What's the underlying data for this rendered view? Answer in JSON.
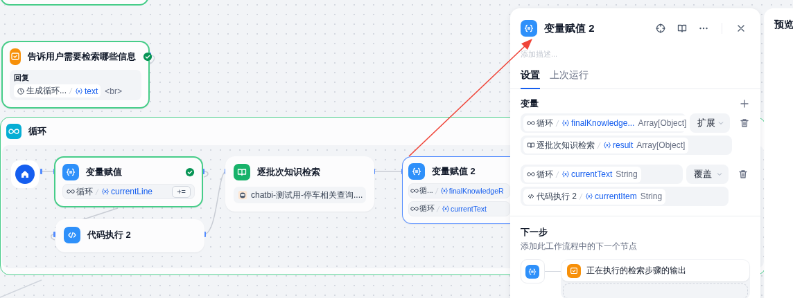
{
  "canvas": {
    "answer_node": {
      "kind": "answer",
      "title": "告诉用户需要检索哪些信息",
      "succeeded": true,
      "section_label": "回复",
      "ref": {
        "source": {
          "kind": "llm",
          "name": "生成循环..."
        },
        "var": "text"
      },
      "suffix": "<br>"
    },
    "loop_node": {
      "kind": "loop",
      "title": "循环",
      "succeeded": true,
      "children": [
        {
          "kind": "start"
        },
        {
          "kind": "assign",
          "title": "变量赋值",
          "succeeded": true,
          "selected": false,
          "rows": [
            {
              "source": {
                "kind": "loop",
                "name": "循环"
              },
              "var": "currentLine",
              "op": "+="
            }
          ]
        },
        {
          "kind": "code",
          "title": "代码执行 2",
          "succeeded": false,
          "selected": false
        },
        {
          "kind": "knowledge",
          "title": "逐批次知识检索",
          "succeeded": false,
          "selected": false,
          "dataset": "chatbi-测试用-停车相关查询...."
        },
        {
          "kind": "assign",
          "title": "变量赋值 2",
          "succeeded": false,
          "selected": true,
          "rows": [
            {
              "source": {
                "kind": "loop",
                "name": "循..."
              },
              "var": "finalKnowledgeR"
            },
            {
              "source": {
                "kind": "loop",
                "name": "循环"
              },
              "var": "currentText"
            }
          ]
        }
      ]
    }
  },
  "panel": {
    "kind": "assign",
    "title": "变量赋值 2",
    "description": {
      "placeholder": "添加描述..."
    },
    "tabs": [
      {
        "label": "设置",
        "selected": true
      },
      {
        "label": "上次运行",
        "selected": false
      }
    ],
    "variables_label": "变量",
    "variables": [
      {
        "target": {
          "source": {
            "kind": "loop",
            "name": "循环"
          },
          "var": "finalKnowledge...",
          "type": "Array[Object]"
        },
        "mode": "扩展",
        "value": {
          "source": {
            "kind": "knowledge",
            "name": "逐批次知识检索"
          },
          "var": "result",
          "type": "Array[Object]"
        }
      },
      {
        "target": {
          "source": {
            "kind": "loop",
            "name": "循环"
          },
          "var": "currentText",
          "type": "String"
        },
        "mode": "覆盖",
        "value": {
          "source": {
            "kind": "code",
            "name": "代码执行 2"
          },
          "var": "currentItem",
          "type": "String"
        }
      }
    ],
    "next_step": {
      "title": "下一步",
      "hint": "添加此工作流程中的下一个节点",
      "nodes": [
        {
          "kind": "answer",
          "title": "正在执行的检索步骤的输出"
        }
      ]
    }
  },
  "preview": {
    "title": "预览"
  }
}
